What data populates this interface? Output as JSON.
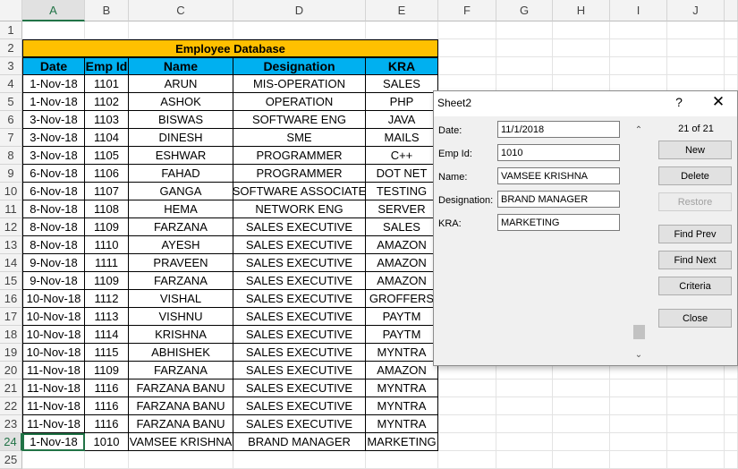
{
  "columns": [
    "A",
    "B",
    "C",
    "D",
    "E",
    "F",
    "G",
    "H",
    "I",
    "J"
  ],
  "rows": [
    "1",
    "2",
    "3",
    "4",
    "5",
    "6",
    "7",
    "8",
    "9",
    "10",
    "11",
    "12",
    "13",
    "14",
    "15",
    "16",
    "17",
    "18",
    "19",
    "20",
    "21",
    "22",
    "23",
    "24",
    "25"
  ],
  "table": {
    "title": "Employee Database",
    "headers": [
      "Date",
      "Emp Id",
      "Name",
      "Designation",
      "KRA"
    ],
    "records": [
      [
        "1-Nov-18",
        "1101",
        "ARUN",
        "MIS-OPERATION",
        "SALES"
      ],
      [
        "1-Nov-18",
        "1102",
        "ASHOK",
        "OPERATION",
        "PHP"
      ],
      [
        "3-Nov-18",
        "1103",
        "BISWAS",
        "SOFTWARE ENG",
        "JAVA"
      ],
      [
        "3-Nov-18",
        "1104",
        "DINESH",
        "SME",
        "MAILS"
      ],
      [
        "3-Nov-18",
        "1105",
        "ESHWAR",
        "PROGRAMMER",
        "C++"
      ],
      [
        "6-Nov-18",
        "1106",
        "FAHAD",
        "PROGRAMMER",
        "DOT NET"
      ],
      [
        "6-Nov-18",
        "1107",
        "GANGA",
        "SOFTWARE ASSOCIATE",
        "TESTING"
      ],
      [
        "8-Nov-18",
        "1108",
        "HEMA",
        "NETWORK ENG",
        "SERVER"
      ],
      [
        "8-Nov-18",
        "1109",
        "FARZANA",
        "SALES EXECUTIVE",
        "SALES"
      ],
      [
        "8-Nov-18",
        "1110",
        "AYESH",
        "SALES EXECUTIVE",
        "AMAZON"
      ],
      [
        "9-Nov-18",
        "1111",
        "PRAVEEN",
        "SALES EXECUTIVE",
        "AMAZON"
      ],
      [
        "9-Nov-18",
        "1109",
        "FARZANA",
        "SALES EXECUTIVE",
        "AMAZON"
      ],
      [
        "10-Nov-18",
        "1112",
        "VISHAL",
        "SALES EXECUTIVE",
        "GROFFERS"
      ],
      [
        "10-Nov-18",
        "1113",
        "VISHNU",
        "SALES EXECUTIVE",
        "PAYTM"
      ],
      [
        "10-Nov-18",
        "1114",
        "KRISHNA",
        "SALES EXECUTIVE",
        "PAYTM"
      ],
      [
        "10-Nov-18",
        "1115",
        "ABHISHEK",
        "SALES EXECUTIVE",
        "MYNTRA"
      ],
      [
        "11-Nov-18",
        "1109",
        "FARZANA",
        "SALES EXECUTIVE",
        "AMAZON"
      ],
      [
        "11-Nov-18",
        "1116",
        "FARZANA BANU",
        "SALES EXECUTIVE",
        "MYNTRA"
      ],
      [
        "11-Nov-18",
        "1116",
        "FARZANA BANU",
        "SALES EXECUTIVE",
        "MYNTRA"
      ],
      [
        "11-Nov-18",
        "1116",
        "FARZANA BANU",
        "SALES EXECUTIVE",
        "MYNTRA"
      ],
      [
        "1-Nov-18",
        "1010",
        "VAMSEE KRISHNA",
        "BRAND MANAGER",
        "MARKETING"
      ]
    ]
  },
  "dialog": {
    "title": "Sheet2",
    "help_glyph": "?",
    "close_glyph": "✕",
    "record_counter": "21 of 21",
    "fields": [
      {
        "label": "Date:",
        "value": "11/1/2018"
      },
      {
        "label": "Emp Id:",
        "value": "1010"
      },
      {
        "label": "Name:",
        "value": "VAMSEE KRISHNA"
      },
      {
        "label": "Designation:",
        "value": "BRAND MANAGER"
      },
      {
        "label": "KRA:",
        "value": "MARKETING"
      }
    ],
    "buttons": {
      "new": "New",
      "delete": "Delete",
      "restore": "Restore",
      "find_prev": "Find Prev",
      "find_next": "Find Next",
      "criteria": "Criteria",
      "close": "Close"
    },
    "scroll_up_glyph": "⌃",
    "scroll_down_glyph": "⌄"
  }
}
